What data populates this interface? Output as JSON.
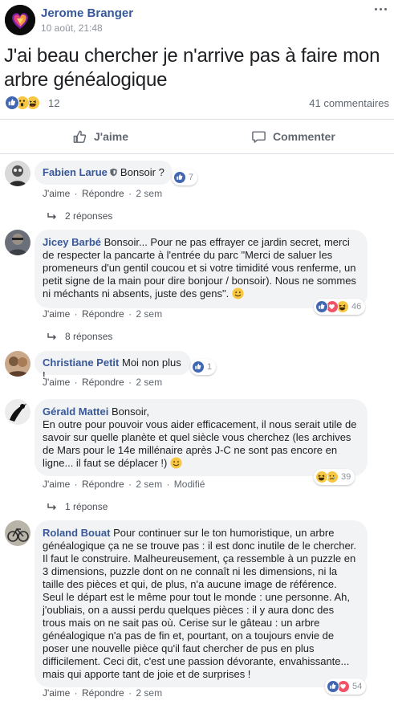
{
  "post": {
    "author": "Jerome Branger",
    "time": "10 août, 21:48",
    "text": "J'ai beau chercher je n'arrive pas à faire mon arbre généalogique",
    "reaction_icons": [
      "like-icon",
      "wow-icon",
      "haha-icon"
    ],
    "reaction_count": "12",
    "comments_count": "41 commentaires"
  },
  "actions": {
    "like_label": "J'aime",
    "comment_label": "Commenter"
  },
  "comment_actions": {
    "like": "J'aime",
    "reply": "Répondre",
    "separator": "·"
  },
  "comments": [
    {
      "author": "Fabien Larue",
      "text": "Bonsoir ?",
      "time": "2 sem",
      "reaction_count": "7",
      "reaction_icons": [
        "like-icon"
      ],
      "replies": "2 réponses"
    },
    {
      "author": "Jicey Barbé",
      "text": "Bonsoir... Pour ne pas effrayer ce jardin secret, merci de respecter la pancarte à l'entrée du parc \"Merci de saluer les promeneurs d'un gentil coucou et si votre timidité vous renferme, un petit signe de la main pour dire bonjour / bonsoir). Nous ne sommes ni méchants ni absents, juste des gens\".",
      "time": "2 sem",
      "reaction_count": "46",
      "reaction_icons": [
        "like-icon",
        "love-icon",
        "haha-icon"
      ],
      "replies": "8 réponses"
    },
    {
      "author": "Christiane Petit",
      "text": "Moi non plus !",
      "time": "2 sem",
      "reaction_count": "1",
      "reaction_icons": [
        "like-icon"
      ]
    },
    {
      "author": "Gérald Mattei",
      "text_line1": "Bonsoir,",
      "text": "En outre pour pouvoir vous aider efficacement, il nous serait utile de savoir sur quelle planète et quel siècle vous cherchez (les archives de Mars pour le 14e millénaire après J-C ne sont pas encore en ligne... il faut se déplacer !)",
      "time": "2 sem",
      "edited": "Modifié",
      "reaction_count": "39",
      "reaction_icons": [
        "haha-icon",
        "sad-icon"
      ],
      "replies": "1 réponse"
    },
    {
      "author": "Roland Bouat",
      "text": "Pour continuer sur le ton humoristique, un arbre généalogique ça ne se trouve pas : il est donc inutile de le chercher. Il faut le construire. Malheureusement, ça ressemble à un puzzle en 3 dimensions, puzzle dont on ne connaît ni les dimensions, ni la taille des pièces et qui, de plus, n'a aucune image de référence. Seul le départ est le même pour tout le monde : une personne. Ah, j'oubliais, on a aussi perdu quelques pièces : il y aura donc des trous mais on ne sait pas où. Cerise sur le gâteau : un arbre généalogique n'a pas de fin et, pourtant, on a toujours envie de poser une nouvelle pièce qu'il faut chercher de pus en plus difficilement. Ceci dit, c'est une passion dévorante, envahissante... mais qui apporte tant de joie et de surprises !",
      "time": "2 sem",
      "reaction_count": "54",
      "reaction_icons": [
        "like-icon",
        "love-icon"
      ]
    }
  ],
  "colors": {
    "link": "#385898",
    "like": "#4267b2",
    "love": "#f25268",
    "yellow": "#f7c744",
    "bubble": "#f2f3f5",
    "meta": "#606770"
  }
}
